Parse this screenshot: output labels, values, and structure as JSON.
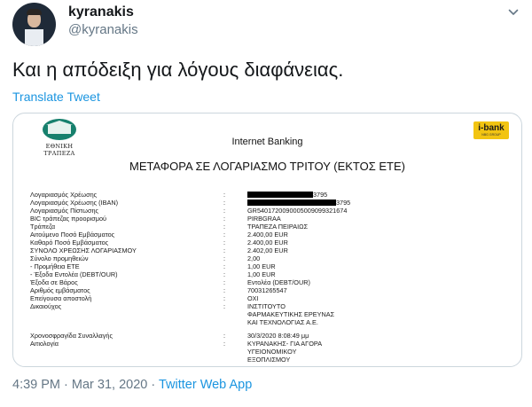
{
  "author": {
    "name": "kyranakis",
    "handle": "@kyranakis"
  },
  "tweet": {
    "text": "Και η απόδειξη για λόγους διαφάνειας.",
    "translate_label": "Translate Tweet"
  },
  "receipt": {
    "bank_logo_text": "ΕΘΝΙΚΗ ΤΡΑΠΕΖΑ",
    "ibank_logo": "i-bank",
    "ibank_sub": "NBG GROUP",
    "title": "Internet Banking",
    "subtitle": "ΜΕΤΑΦΟΡΑ ΣΕ ΛΟΓΑΡΙΑΣΜΟ ΤΡΙΤΟΥ (ΕΚΤΟΣ ΕΤΕ)",
    "rows": [
      {
        "label": "Λογαριασμός Χρέωσης",
        "value": "3795"
      },
      {
        "label": "Λογαριασμός Χρέωσης (IBAN)",
        "value": "3795"
      },
      {
        "label": "Λογαριασμός Πίστωσης",
        "value": "GR5401720090005009099321674"
      },
      {
        "label": "BIC τράπεζας προορισμού",
        "value": "PIRBGRAA"
      },
      {
        "label": "Τράπεζα",
        "value": "ΤΡΑΠΕΖΑ ΠΕΙΡΑΙΩΣ"
      },
      {
        "label": "Αιτούμενο Ποσό Εμβάσματος",
        "value": "2.400,00 EUR"
      },
      {
        "label": "Καθαρό Ποσό Εμβάσματος",
        "value": "2.400,00 EUR"
      },
      {
        "label": "ΣΥΝΟΛΟ ΧΡΕΩΣΗΣ ΛΟΓΑΡΙΑΣΜΟΥ",
        "value": "2.402,00 EUR"
      },
      {
        "label": "Σύνολο προμηθειών",
        "value": "2,00"
      },
      {
        "label": "- Προμήθεια ΕΤΕ",
        "value": "1,00 EUR"
      },
      {
        "label": "- Έξοδα Εντολέα (DEBT/OUR)",
        "value": "1,00 EUR"
      },
      {
        "label": "Έξοδα σε Βάρος",
        "value": "Εντολέα (DEBT/OUR)"
      },
      {
        "label": "Αριθμός εμβάσματος",
        "value": "70031265547"
      },
      {
        "label": "Επείγουσα αποστολή",
        "value": "ΟΧΙ"
      },
      {
        "label": "Δικαιούχος",
        "value": "ΙΝΣΤΙΤΟΥΤΟ"
      },
      {
        "label": "",
        "value": "ΦΑΡΜΑΚΕΥΤΙΚΗΣ ΕΡΕΥΝΑΣ"
      },
      {
        "label": "",
        "value": "ΚΑΙ ΤΕΧΝΟΛΟΓΙΑΣ Α.Ε."
      },
      {
        "label": "Χρονοσφραγίδα Συναλλαγής",
        "value": "30/3/2020 8:08:49 μμ"
      },
      {
        "label": "Αιτιολογία",
        "value": "ΚΥΡΑΝΑΚΗΣ- ΓΙΑ ΑΓΟΡΑ"
      },
      {
        "label": "",
        "value": "ΥΓΕΙΟΝΟΜΙΚΟΥ"
      },
      {
        "label": "",
        "value": "ΕΞΟΠΛΙΣΜΟΥ"
      }
    ]
  },
  "meta": {
    "time": "4:39 PM",
    "separator": " · ",
    "date": "Mar 31, 2020",
    "app": "Twitter Web App"
  }
}
